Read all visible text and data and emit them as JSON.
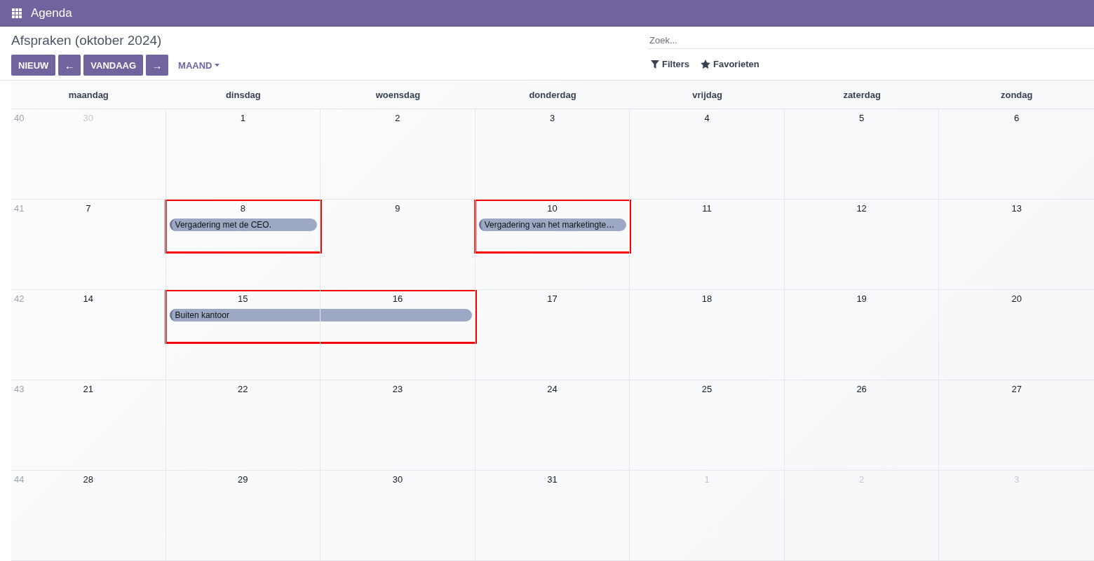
{
  "app_bar": {
    "title": "Agenda"
  },
  "page_title": "Afspraken (oktober 2024)",
  "toolbar": {
    "new_button": "NIEUW",
    "prev_button": "←",
    "today_button": "VANDAAG",
    "next_button": "→",
    "scale_dropdown": "MAAND"
  },
  "search": {
    "placeholder": "Zoek...",
    "filters": "Filters",
    "favorites": "Favorieten"
  },
  "weekdays": [
    "maandag",
    "dinsdag",
    "woensdag",
    "donderdag",
    "vrijdag",
    "zaterdag",
    "zondag"
  ],
  "weeks": [
    {
      "number": "40",
      "days": [
        {
          "label": "30",
          "in_month": false
        },
        {
          "label": "1",
          "in_month": true
        },
        {
          "label": "2",
          "in_month": true
        },
        {
          "label": "3",
          "in_month": true
        },
        {
          "label": "4",
          "in_month": true
        },
        {
          "label": "5",
          "in_month": true
        },
        {
          "label": "6",
          "in_month": true
        }
      ]
    },
    {
      "number": "41",
      "days": [
        {
          "label": "7",
          "in_month": true
        },
        {
          "label": "8",
          "in_month": true,
          "events": [
            {
              "title": "Vergadering met de CEO.",
              "through_next_day": false,
              "highlighted": true
            }
          ]
        },
        {
          "label": "9",
          "in_month": true
        },
        {
          "label": "10",
          "in_month": true,
          "events": [
            {
              "title": "Vergadering van het marketingte…",
              "through_next_day": false,
              "highlighted": true
            }
          ]
        },
        {
          "label": "11",
          "in_month": true
        },
        {
          "label": "12",
          "in_month": true
        },
        {
          "label": "13",
          "in_month": true
        }
      ]
    },
    {
      "number": "42",
      "days": [
        {
          "label": "14",
          "in_month": true
        },
        {
          "label": "15",
          "in_month": true,
          "events": [
            {
              "title": "Buiten kantoor",
              "through_next_day": true,
              "highlighted": true
            }
          ]
        },
        {
          "label": "16",
          "in_month": true
        },
        {
          "label": "17",
          "in_month": true
        },
        {
          "label": "18",
          "in_month": true
        },
        {
          "label": "19",
          "in_month": true
        },
        {
          "label": "20",
          "in_month": true
        }
      ]
    },
    {
      "number": "43",
      "days": [
        {
          "label": "21",
          "in_month": true
        },
        {
          "label": "22",
          "in_month": true
        },
        {
          "label": "23",
          "in_month": true
        },
        {
          "label": "24",
          "in_month": true
        },
        {
          "label": "25",
          "in_month": true
        },
        {
          "label": "26",
          "in_month": true
        },
        {
          "label": "27",
          "in_month": true
        }
      ]
    },
    {
      "number": "44",
      "days": [
        {
          "label": "28",
          "in_month": true
        },
        {
          "label": "29",
          "in_month": true
        },
        {
          "label": "30",
          "in_month": true
        },
        {
          "label": "31",
          "in_month": true
        },
        {
          "label": "1",
          "in_month": false
        },
        {
          "label": "2",
          "in_month": false
        },
        {
          "label": "3",
          "in_month": false
        }
      ]
    }
  ]
}
